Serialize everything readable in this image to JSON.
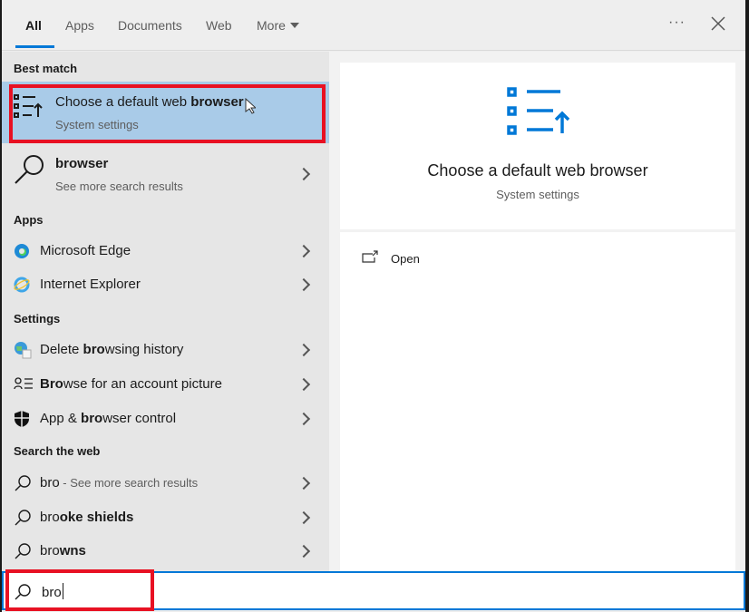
{
  "tabs": {
    "items": [
      {
        "label": "All"
      },
      {
        "label": "Apps"
      },
      {
        "label": "Documents"
      },
      {
        "label": "Web"
      },
      {
        "label": "More"
      }
    ],
    "active": "All",
    "more_icon": "dropdown-triangle",
    "dots": "···"
  },
  "sections": {
    "best_match": "Best match",
    "apps": "Apps",
    "settings": "Settings",
    "web": "Search the web"
  },
  "best": {
    "pre": "Choose a default web ",
    "bold": "browser",
    "post": "",
    "sub": "System settings",
    "icon": "default-apps-list-icon"
  },
  "browser_search": {
    "pre": "",
    "bold": "browser",
    "post": "",
    "sub": "See more search results",
    "icon": "search-icon"
  },
  "apps": [
    {
      "label": "Microsoft Edge",
      "icon": "edge-icon"
    },
    {
      "label": "Internet Explorer",
      "icon": "ie-icon"
    }
  ],
  "settings": [
    {
      "pre": "Delete ",
      "bold": "bro",
      "post": "wsing history",
      "icon": "globe-settings-icon"
    },
    {
      "pre": "",
      "bold": "Bro",
      "post": "wse for an account picture",
      "icon": "account-picture-icon"
    },
    {
      "pre": "App & ",
      "bold": "bro",
      "post": "wser control",
      "icon": "shield-icon"
    }
  ],
  "web": [
    {
      "pre": "bro",
      "bold": "",
      "post": "",
      "sub": " - See more search results"
    },
    {
      "pre": "bro",
      "bold": "oke shields",
      "post": ""
    },
    {
      "pre": "bro",
      "bold": "wns",
      "post": ""
    }
  ],
  "preview": {
    "title": "Choose a default web browser",
    "sub": "System settings",
    "action": "Open",
    "accent": "#0078d7"
  },
  "search": {
    "value": "bro"
  },
  "colors": {
    "accent": "#0078d7",
    "selected": "#a9cbe8",
    "highlight": "#e81123"
  }
}
